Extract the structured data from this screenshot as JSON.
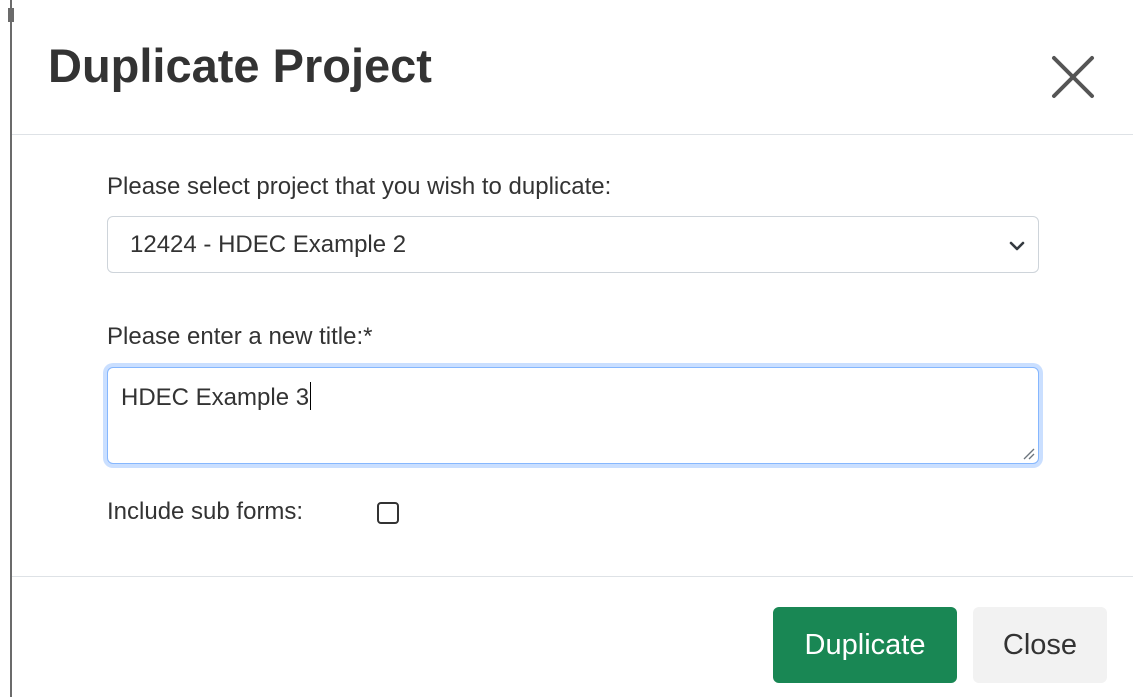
{
  "dialog": {
    "title": "Duplicate Project"
  },
  "form": {
    "select_label": "Please select project that you wish to duplicate:",
    "select_value": "12424 - HDEC Example 2",
    "title_label": "Please enter a new title:*",
    "title_value": "HDEC Example 3",
    "subforms_label": "Include sub forms:",
    "subforms_checked": false
  },
  "footer": {
    "duplicate_label": "Duplicate",
    "close_label": "Close"
  },
  "colors": {
    "primary_green": "#198754",
    "focus_blue": "#86b7fe",
    "text": "#333333",
    "secondary_button_bg": "#f2f2f2"
  },
  "icons": {
    "close": "close-x-icon",
    "dropdown": "chevron-down-icon",
    "resize": "resize-grip-icon"
  }
}
